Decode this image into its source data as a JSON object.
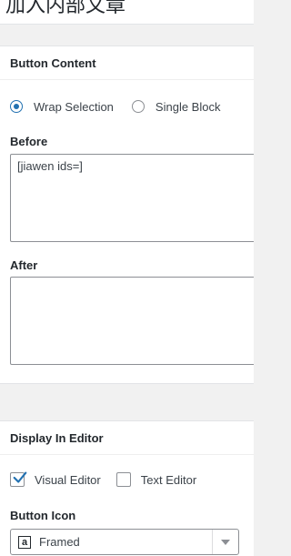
{
  "page": {
    "title": "加入内部文章"
  },
  "button_content": {
    "heading": "Button Content",
    "radios": [
      {
        "label": "Wrap Selection",
        "checked": true
      },
      {
        "label": "Single Block",
        "checked": false
      }
    ],
    "before": {
      "label": "Before",
      "value": "[jiawen ids=]"
    },
    "after": {
      "label": "After",
      "value": ""
    }
  },
  "display_in_editor": {
    "heading": "Display In Editor",
    "checkboxes": [
      {
        "label": "Visual Editor",
        "checked": true
      },
      {
        "label": "Text Editor",
        "checked": false
      }
    ],
    "button_icon": {
      "label": "Button Icon",
      "selected": "Framed",
      "icon_glyph": "a",
      "icon_name": "framed-a-icon"
    }
  },
  "colors": {
    "accent": "#2271b1",
    "border": "#8c8f94",
    "background": "#f1f1f1",
    "panel": "#ffffff"
  }
}
